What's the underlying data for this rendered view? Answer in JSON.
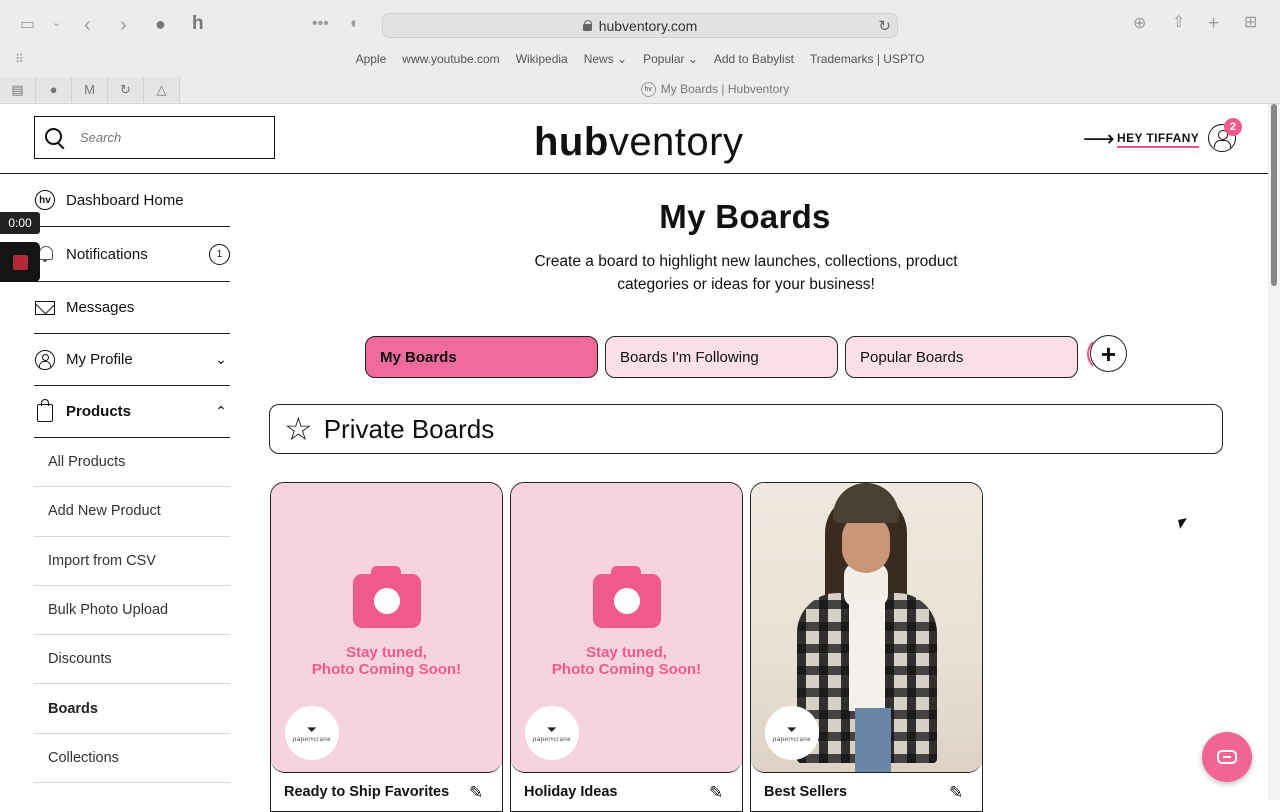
{
  "browser": {
    "url": "hubventory.com",
    "favorites": [
      "Apple",
      "www.youtube.com",
      "Wikipedia",
      "News ⌄",
      "Popular ⌄",
      "Add to Babylist",
      "Trademarks | USPTO"
    ],
    "tab_title": "My Boards | Hubventory",
    "tab_favicon": "hv"
  },
  "header": {
    "search_placeholder": "Search",
    "logo_bold": "hub",
    "logo_light": "ventory",
    "greeting": "HEY TIFFANY",
    "notification_count": "2"
  },
  "recording": {
    "time": "0:00"
  },
  "sidebar": {
    "home_icon_text": "hv",
    "items": [
      {
        "label": "Dashboard Home"
      },
      {
        "label": "Notifications",
        "badge": "1"
      },
      {
        "label": "Messages"
      },
      {
        "label": "My Profile"
      },
      {
        "label": "Products"
      }
    ],
    "products_sub": [
      {
        "label": "All Products"
      },
      {
        "label": "Add New Product"
      },
      {
        "label": "Import from CSV"
      },
      {
        "label": "Bulk Photo Upload"
      },
      {
        "label": "Discounts"
      },
      {
        "label": "Boards"
      },
      {
        "label": "Collections"
      }
    ]
  },
  "main": {
    "title": "My Boards",
    "subtitle": "Create a board to highlight new launches, collections, product categories or ideas for your business!",
    "tabs": [
      {
        "label": "My Boards"
      },
      {
        "label": "Boards I'm Following"
      },
      {
        "label": "Popular Boards"
      }
    ],
    "add_symbol": "+",
    "section_title": "Private Boards",
    "placeholder_text_1": "Stay tuned,",
    "placeholder_text_2": "Photo Coming Soon!",
    "brand_text": "paper•crane",
    "cards": [
      {
        "name": "Ready to Ship Favorites"
      },
      {
        "name": "Holiday Ideas"
      },
      {
        "name": "Best Sellers"
      }
    ]
  },
  "colors": {
    "accent": "#ef5a8e",
    "tab_bg": "#fbe0ec",
    "active_tab": "#ee6b9c",
    "placeholder_bg": "#f7d2e0"
  }
}
